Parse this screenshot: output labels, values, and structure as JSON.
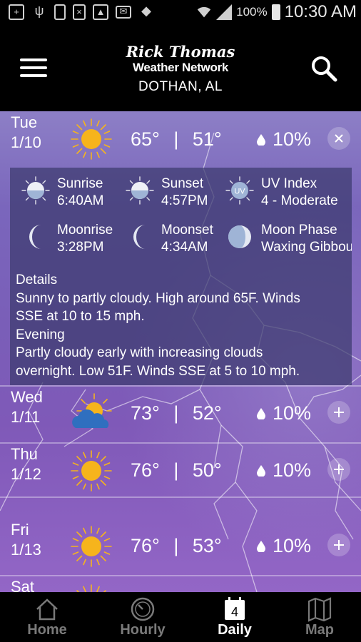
{
  "status_bar": {
    "battery_percent": "100%",
    "time": "10:30 AM",
    "icons": [
      "add-box-icon",
      "usb-icon",
      "battery-saver-icon",
      "no-sim-icon",
      "image-icon",
      "email-icon",
      "dropbox-icon",
      "wifi-icon",
      "signal-icon",
      "battery-icon"
    ]
  },
  "header": {
    "brand_script": "Rick Thomas",
    "brand_name": "Weather Network",
    "city": "DOTHAN, AL",
    "menu_icon": "hamburger-menu-icon",
    "search_icon": "search-icon"
  },
  "days": [
    {
      "name": "Tue",
      "date": "1/10",
      "icon": "sunny-icon",
      "high": "65°",
      "separator": "|",
      "low": "51°",
      "precip": "10%",
      "toggle": "collapse",
      "toggle_icon": "close-icon"
    },
    {
      "name": "Wed",
      "date": "1/11",
      "icon": "partly-cloudy-icon",
      "high": "73°",
      "separator": "|",
      "low": "52°",
      "precip": "10%",
      "toggle": "expand",
      "toggle_icon": "plus-icon"
    },
    {
      "name": "Thu",
      "date": "1/12",
      "icon": "sunny-icon",
      "high": "76°",
      "separator": "|",
      "low": "50°",
      "precip": "10%",
      "toggle": "expand",
      "toggle_icon": "plus-icon"
    },
    {
      "name": "Fri",
      "date": "1/13",
      "icon": "sunny-icon",
      "high": "76°",
      "separator": "|",
      "low": "53°",
      "precip": "10%",
      "toggle": "expand",
      "toggle_icon": "plus-icon"
    },
    {
      "name": "Sat",
      "date": "",
      "icon": "sunny-icon"
    }
  ],
  "details": {
    "sunrise": {
      "label": "Sunrise",
      "value": "6:40AM",
      "icon": "sunrise-icon"
    },
    "sunset": {
      "label": "Sunset",
      "value": "4:57PM",
      "icon": "sunset-icon"
    },
    "uv": {
      "label": "UV Index",
      "value": "4 - Moderate",
      "icon": "uv-icon",
      "badge": "UV"
    },
    "moonrise": {
      "label": "Moonrise",
      "value": "3:28PM",
      "icon": "moonrise-icon"
    },
    "moonset": {
      "label": "Moonset",
      "value": "4:34AM",
      "icon": "moonset-icon"
    },
    "moonphase": {
      "label": "Moon Phase",
      "value": "Waxing Gibbous",
      "icon": "moon-phase-icon"
    },
    "lines": [
      "Details",
      "Sunny to partly cloudy. High around 65F. Winds",
      "SSE at 10 to 15 mph.",
      "Evening",
      "Partly cloudy early with increasing clouds",
      "overnight. Low 51F. Winds SSE at 5 to 10 mph."
    ]
  },
  "bottom_nav": [
    {
      "label": "Home",
      "icon": "home-icon",
      "active": false
    },
    {
      "label": "Hourly",
      "icon": "clock-icon",
      "active": false
    },
    {
      "label": "Daily",
      "icon": "calendar-icon",
      "badge": "4",
      "active": true
    },
    {
      "label": "Map",
      "icon": "map-icon",
      "active": false
    }
  ],
  "colors": {
    "sun": "#f6b41c",
    "cloud": "#2f6fbf",
    "background_top": "#8d7fc6",
    "background_bottom": "#9366c6",
    "details_panel": "#3c3a6e"
  }
}
